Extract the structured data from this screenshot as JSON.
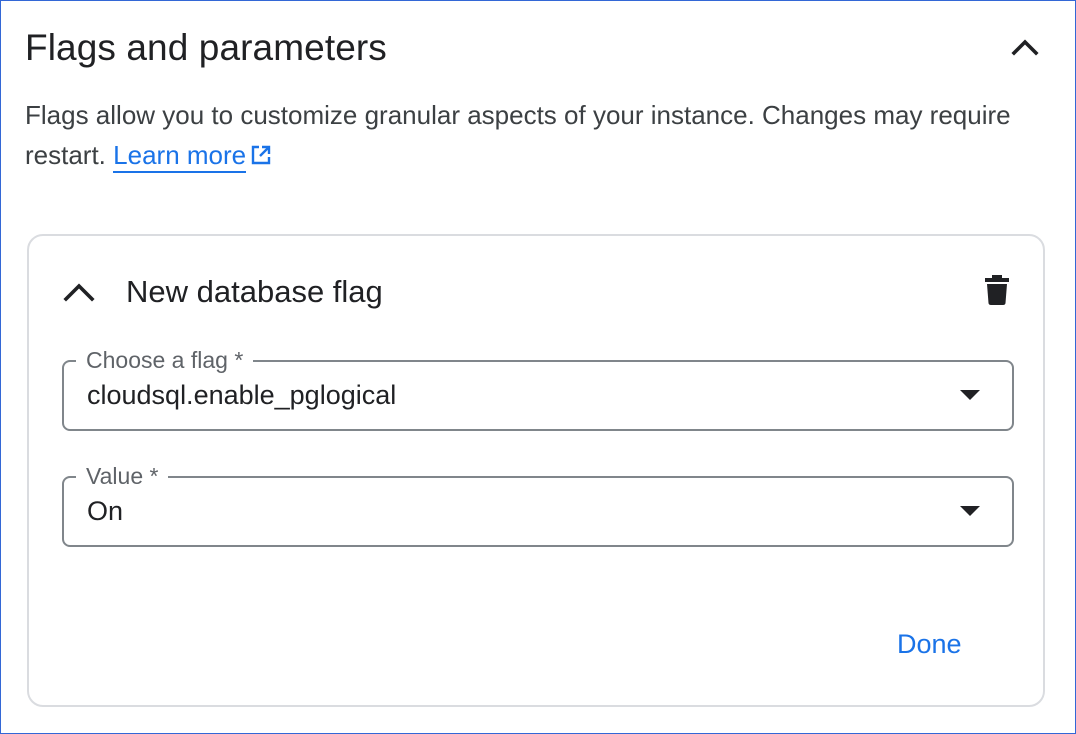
{
  "section": {
    "title": "Flags and parameters",
    "description": "Flags allow you to customize granular aspects of your instance. Changes may require restart.",
    "learn_more_label": "Learn more"
  },
  "flag_card": {
    "title": "New database flag",
    "flag_field": {
      "label": "Choose a flag *",
      "value": "cloudsql.enable_pglogical"
    },
    "value_field": {
      "label": "Value *",
      "value": "On"
    },
    "done_label": "Done"
  },
  "icons": {
    "collapse_section": "chevron-up-icon",
    "learn_more": "open-in-new-icon",
    "collapse_card": "chevron-up-icon",
    "delete": "trash-icon",
    "dropdown": "arrow-drop-down-icon"
  },
  "colors": {
    "link": "#1a73e8",
    "border_focus": "#3367d6",
    "card_border": "#dadce0",
    "field_border": "#80868b"
  }
}
